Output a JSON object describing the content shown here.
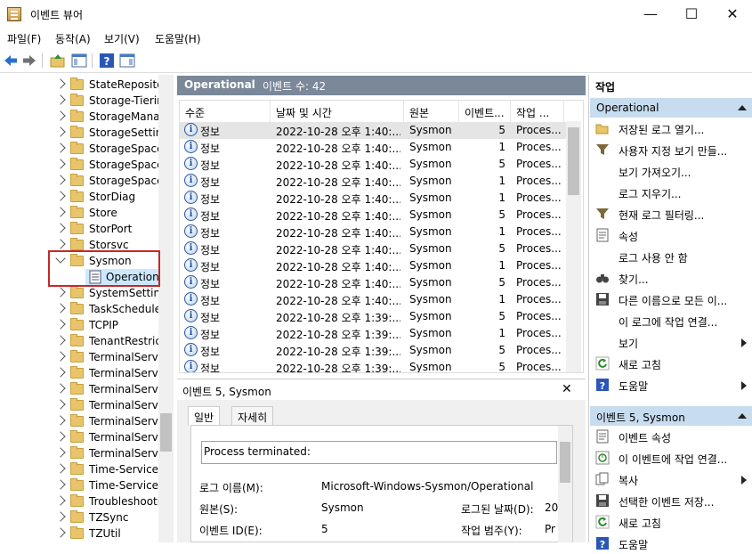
{
  "window": {
    "title": "이벤트 뷰어",
    "minimize": "—",
    "maximize": "☐",
    "close": "✕"
  },
  "menu": [
    "파일(F)",
    "동작(A)",
    "보기(V)",
    "도움말(H)"
  ],
  "tree": {
    "items": [
      {
        "label": "StateRepository"
      },
      {
        "label": "Storage-Tiering"
      },
      {
        "label": "StorageManagement"
      },
      {
        "label": "StorageSettings"
      },
      {
        "label": "StorageSpaces-"
      },
      {
        "label": "StorageSpaces-"
      },
      {
        "label": "StorageSpaces-"
      },
      {
        "label": "StorDiag"
      },
      {
        "label": "Store"
      },
      {
        "label": "StorPort"
      },
      {
        "label": "Storsvc"
      },
      {
        "label": "Sysmon"
      },
      {
        "label": "Operational"
      },
      {
        "label": "SystemSettings"
      },
      {
        "label": "TaskScheduler"
      },
      {
        "label": "TCPIP"
      },
      {
        "label": "TenantRestrictions"
      },
      {
        "label": "TerminalServices"
      },
      {
        "label": "TerminalServices"
      },
      {
        "label": "TerminalServices"
      },
      {
        "label": "TerminalServices"
      },
      {
        "label": "TerminalServices"
      },
      {
        "label": "TerminalServices"
      },
      {
        "label": "TerminalServices"
      },
      {
        "label": "Time-Service"
      },
      {
        "label": "Time-Service-P"
      },
      {
        "label": "Troubleshooting"
      },
      {
        "label": "TZSync"
      },
      {
        "label": "TZUtil"
      }
    ]
  },
  "center": {
    "log_name": "Operational",
    "event_count": "이벤트 수: 42",
    "columns": [
      "수준",
      "날짜 및 시간",
      "원본",
      "이벤트...",
      "작업 ..."
    ],
    "rows": [
      {
        "level": "정보",
        "datetime": "2022-10-28 오후 1:40:...",
        "source": "Sysmon",
        "event": "5",
        "task": "Proces..."
      },
      {
        "level": "정보",
        "datetime": "2022-10-28 오후 1:40:...",
        "source": "Sysmon",
        "event": "1",
        "task": "Proces..."
      },
      {
        "level": "정보",
        "datetime": "2022-10-28 오후 1:40:...",
        "source": "Sysmon",
        "event": "5",
        "task": "Proces..."
      },
      {
        "level": "정보",
        "datetime": "2022-10-28 오후 1:40:...",
        "source": "Sysmon",
        "event": "1",
        "task": "Proces..."
      },
      {
        "level": "정보",
        "datetime": "2022-10-28 오후 1:40:...",
        "source": "Sysmon",
        "event": "1",
        "task": "Proces..."
      },
      {
        "level": "정보",
        "datetime": "2022-10-28 오후 1:40:...",
        "source": "Sysmon",
        "event": "5",
        "task": "Proces..."
      },
      {
        "level": "정보",
        "datetime": "2022-10-28 오후 1:40:...",
        "source": "Sysmon",
        "event": "1",
        "task": "Proces..."
      },
      {
        "level": "정보",
        "datetime": "2022-10-28 오후 1:40:...",
        "source": "Sysmon",
        "event": "5",
        "task": "Proces..."
      },
      {
        "level": "정보",
        "datetime": "2022-10-28 오후 1:40:...",
        "source": "Sysmon",
        "event": "1",
        "task": "Proces..."
      },
      {
        "level": "정보",
        "datetime": "2022-10-28 오후 1:40:...",
        "source": "Sysmon",
        "event": "5",
        "task": "Proces..."
      },
      {
        "level": "정보",
        "datetime": "2022-10-28 오후 1:40:...",
        "source": "Sysmon",
        "event": "1",
        "task": "Proces..."
      },
      {
        "level": "정보",
        "datetime": "2022-10-28 오후 1:39:...",
        "source": "Sysmon",
        "event": "5",
        "task": "Proces..."
      },
      {
        "level": "정보",
        "datetime": "2022-10-28 오후 1:39:...",
        "source": "Sysmon",
        "event": "1",
        "task": "Proces..."
      },
      {
        "level": "정보",
        "datetime": "2022-10-28 오후 1:39:...",
        "source": "Sysmon",
        "event": "5",
        "task": "Proces..."
      },
      {
        "level": "정보",
        "datetime": "2022-10-28 오후 1:39:...",
        "source": "Sysmon",
        "event": "5",
        "task": "Proces..."
      }
    ]
  },
  "detail": {
    "title": "이벤트 5, Sysmon",
    "close": "✕",
    "tabs": [
      "일반",
      "자세히"
    ],
    "message": "Process terminated:",
    "fields": {
      "log_name_label": "로그 이름(M):",
      "log_name_value": "Microsoft-Windows-Sysmon/Operational",
      "source_label": "원본(S):",
      "source_value": "Sysmon",
      "logged_label": "로그된 날짜(D):",
      "logged_value": "20",
      "event_id_label": "이벤트 ID(E):",
      "event_id_value": "5",
      "task_label": "작업 범주(Y):",
      "task_value": "Pr"
    }
  },
  "actions": {
    "header": "작업",
    "section1": "Operational",
    "items1": [
      {
        "label": "저장된 로그 열기...",
        "icon": "folder-open-icon"
      },
      {
        "label": "사용자 지정 보기 만들...",
        "icon": "filter-icon"
      },
      {
        "label": "보기 가져오기...",
        "icon": "none"
      },
      {
        "label": "로그 지우기...",
        "icon": "none"
      },
      {
        "label": "현재 로그 필터링...",
        "icon": "filter-icon"
      },
      {
        "label": "속성",
        "icon": "properties-icon"
      },
      {
        "label": "로그 사용 안 함",
        "icon": "none"
      },
      {
        "label": "찾기...",
        "icon": "binoculars-icon"
      },
      {
        "label": "다른 이름으로 모든 이...",
        "icon": "save-icon"
      },
      {
        "label": "이 로그에 작업 연결...",
        "icon": "none"
      },
      {
        "label": "보기",
        "icon": "none",
        "submenu": true
      },
      {
        "label": "새로 고침",
        "icon": "refresh-icon"
      },
      {
        "label": "도움말",
        "icon": "help-icon",
        "submenu": true
      }
    ],
    "section2": "이벤트 5, Sysmon",
    "items2": [
      {
        "label": "이벤트 속성",
        "icon": "properties-icon"
      },
      {
        "label": "이 이벤트에 작업 연결...",
        "icon": "task-icon"
      },
      {
        "label": "복사",
        "icon": "copy-icon",
        "submenu": true
      },
      {
        "label": "선택한 이벤트 저장...",
        "icon": "save-icon"
      },
      {
        "label": "새로 고침",
        "icon": "refresh-icon"
      },
      {
        "label": "도움말",
        "icon": "help-icon"
      }
    ]
  }
}
